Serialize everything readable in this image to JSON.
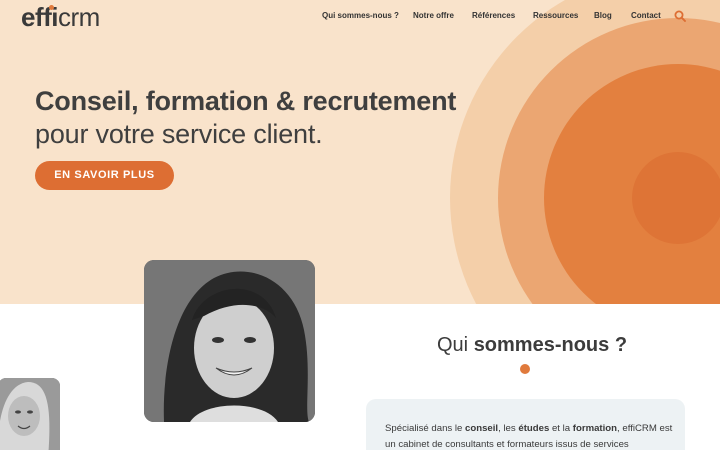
{
  "header": {
    "logo": {
      "bold": "effi",
      "regular": "crm"
    },
    "nav": [
      {
        "label": "Qui sommes-nous ?"
      },
      {
        "label": "Notre offre"
      },
      {
        "label": "Références"
      },
      {
        "label": "Ressources"
      },
      {
        "label": "Blog"
      },
      {
        "label": "Contact"
      }
    ],
    "search_icon": "search-icon"
  },
  "hero": {
    "headline": "Conseil, formation & recrutement",
    "subline": "pour votre service client.",
    "cta_label": "EN SAVOIR PLUS"
  },
  "about": {
    "title_regular": "Qui",
    "title_bold": "sommes-nous ?",
    "body": {
      "p1": "Spécialisé dans le",
      "b1": "conseil",
      "p2": ", les",
      "b2": "études",
      "p3": "et la",
      "b3": "formation",
      "p4": ", effiCRM est un cabinet de consultants et formateurs issus de services"
    }
  },
  "colors": {
    "accent": "#dd6e33",
    "hero_bg": "#f9e3cb",
    "card_bg": "#edf2f4"
  }
}
